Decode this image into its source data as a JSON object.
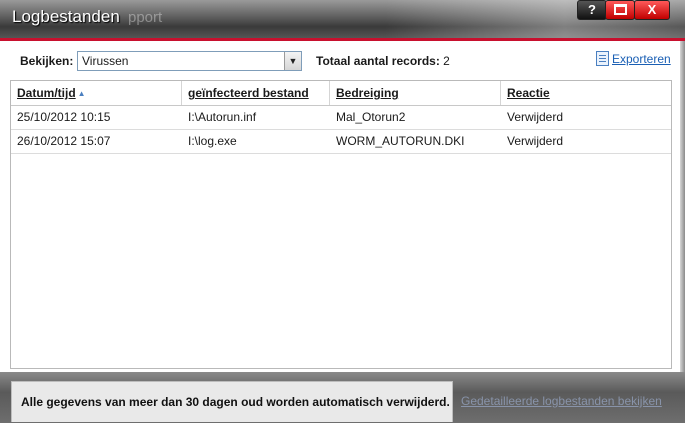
{
  "window": {
    "title": "Logbestanden",
    "title_ghost": "pport",
    "buttons": {
      "help": "?",
      "close": "X"
    }
  },
  "toolbar": {
    "view_label": "Bekijken:",
    "view_selected": "Virussen",
    "total_label": "Totaal aantal records:",
    "total_value": "2",
    "export_label": "Exporteren"
  },
  "table": {
    "columns": [
      "Datum/tijd",
      "geïnfecteerd bestand",
      "Bedreiging",
      "Reactie"
    ],
    "rows": [
      [
        "25/10/2012 10:15",
        "I:\\Autorun.inf",
        "Mal_Otorun2",
        "Verwijderd"
      ],
      [
        "26/10/2012 15:07",
        "I:\\log.exe",
        "WORM_AUTORUN.DKI",
        "Verwijderd"
      ]
    ]
  },
  "footer": {
    "notice": "Alle gegevens van meer dan 30 dagen oud worden automatisch verwijderd.",
    "detail_link": "Gedetailleerde logbestanden bekijken"
  },
  "colors": {
    "accent_red": "#c8102e",
    "link_blue": "#1a5fb4",
    "titlebar_dark": "#3a3a3a"
  },
  "icons": [
    "sort-ascending-icon",
    "dropdown-arrow-icon",
    "export-document-icon",
    "help-icon",
    "maximize-icon",
    "close-icon"
  ]
}
